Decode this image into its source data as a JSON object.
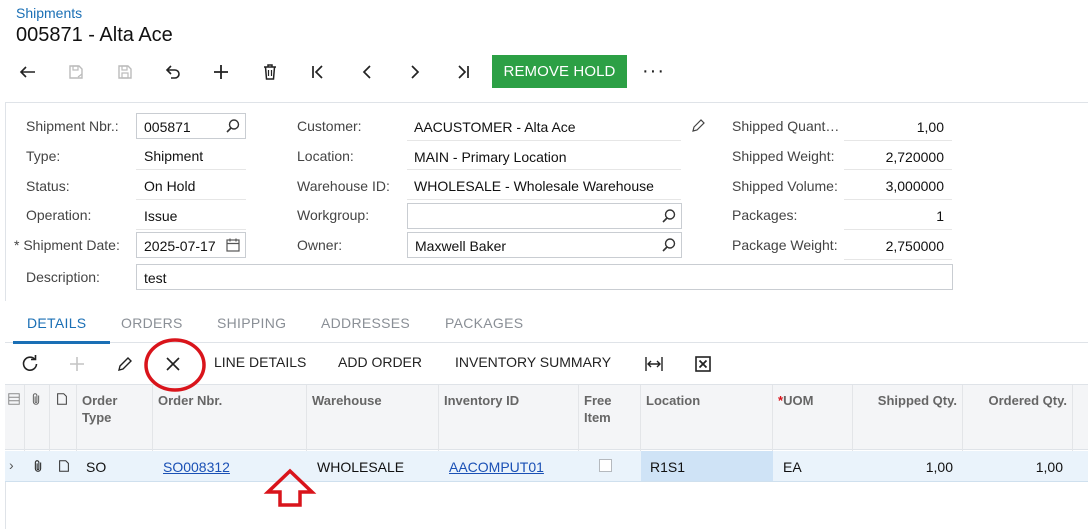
{
  "header": {
    "breadcrumb": "Shipments",
    "title": "005871 - Alta Ace"
  },
  "toolbar": {
    "remove_hold_label": "REMOVE HOLD",
    "more_label": "···",
    "accent_color": "#2ca045"
  },
  "form": {
    "shipment_nbr_label": "Shipment Nbr.:",
    "shipment_nbr_value": "005871",
    "type_label": "Type:",
    "type_value": "Shipment",
    "status_label": "Status:",
    "status_value": "On Hold",
    "operation_label": "Operation:",
    "operation_value": "Issue",
    "required_marker": "*",
    "shipment_date_label": "Shipment Date:",
    "shipment_date_value": "2025-07-17",
    "description_label": "Description:",
    "description_value": "test",
    "customer_label": "Customer:",
    "customer_value": "AACUSTOMER - Alta Ace",
    "location_label": "Location:",
    "location_value": "MAIN - Primary Location",
    "warehouse_label": "Warehouse ID:",
    "warehouse_value": "WHOLESALE - Wholesale Warehouse",
    "workgroup_label": "Workgroup:",
    "workgroup_value": "",
    "owner_label": "Owner:",
    "owner_value": "Maxwell Baker",
    "shipped_qty_label": "Shipped Quant…",
    "shipped_qty_value": "1,00",
    "shipped_weight_label": "Shipped Weight:",
    "shipped_weight_value": "2,720000",
    "shipped_volume_label": "Shipped Volume:",
    "shipped_volume_value": "3,000000",
    "packages_label": "Packages:",
    "packages_value": "1",
    "package_weight_label": "Package Weight:",
    "package_weight_value": "2,750000"
  },
  "tabs": [
    {
      "label": "DETAILS"
    },
    {
      "label": "ORDERS"
    },
    {
      "label": "SHIPPING"
    },
    {
      "label": "ADDRESSES"
    },
    {
      "label": "PACKAGES"
    }
  ],
  "grid_toolbar": {
    "line_details": "LINE DETAILS",
    "add_order": "ADD ORDER",
    "inventory_summary": "INVENTORY SUMMARY"
  },
  "grid": {
    "columns": {
      "order_type": "Order Type",
      "order_nbr": "Order Nbr.",
      "warehouse": "Warehouse",
      "inventory_id": "Inventory ID",
      "free_item": "Free Item",
      "location": "Location",
      "uom_required": "*",
      "uom": "UOM",
      "shipped_qty": "Shipped Qty.",
      "ordered_qty": "Ordered Qty."
    },
    "rows": [
      {
        "order_type": "SO",
        "order_nbr": "SO008312",
        "warehouse": "WHOLESALE",
        "inventory_id": "AACOMPUT01",
        "location": "R1S1",
        "uom": "EA",
        "shipped_qty": "1,00",
        "ordered_qty": "1,00"
      }
    ]
  },
  "annotations": {
    "highlight_color": "#d9141b"
  }
}
